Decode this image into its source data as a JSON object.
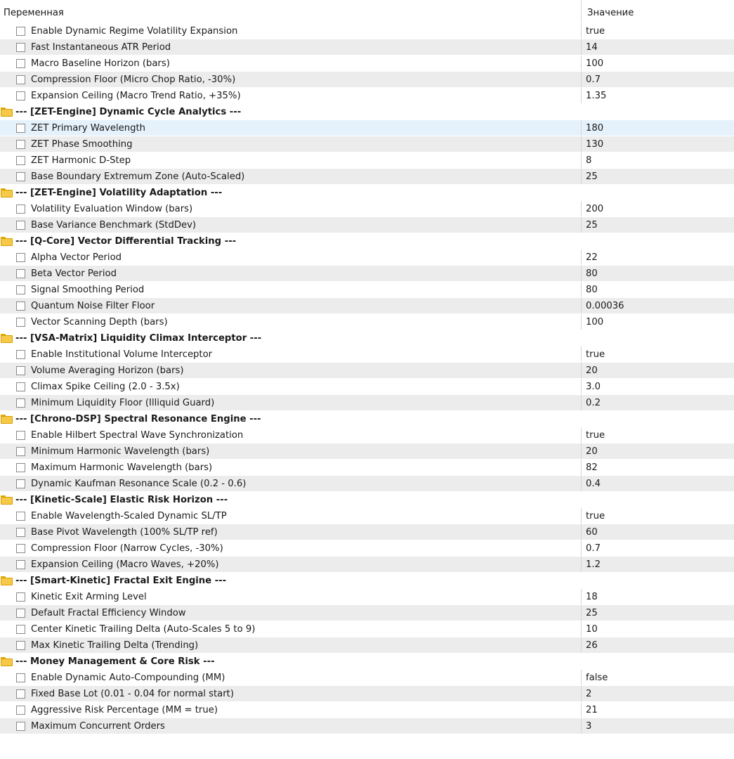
{
  "header": {
    "name_label": "Переменная",
    "value_label": "Значение"
  },
  "rows": [
    {
      "type": "param",
      "name": "Enable Dynamic Regime Volatility Expansion",
      "value": "true"
    },
    {
      "type": "param",
      "name": "Fast Instantaneous ATR Period",
      "value": "14"
    },
    {
      "type": "param",
      "name": "Macro Baseline Horizon (bars)",
      "value": "100"
    },
    {
      "type": "param",
      "name": "Compression Floor (Micro Chop Ratio, -30%)",
      "value": "0.7"
    },
    {
      "type": "param",
      "name": "Expansion Ceiling (Macro Trend Ratio, +35%)",
      "value": "1.35"
    },
    {
      "type": "group",
      "name": "--- [ZET-Engine] Dynamic Cycle Analytics ---"
    },
    {
      "type": "param",
      "name": "ZET Primary Wavelength",
      "value": "180",
      "selected": true
    },
    {
      "type": "param",
      "name": "ZET Phase Smoothing",
      "value": "130"
    },
    {
      "type": "param",
      "name": "ZET Harmonic D-Step",
      "value": "8"
    },
    {
      "type": "param",
      "name": "Base Boundary Extremum Zone (Auto-Scaled)",
      "value": "25"
    },
    {
      "type": "group",
      "name": "--- [ZET-Engine] Volatility Adaptation ---"
    },
    {
      "type": "param",
      "name": "Volatility Evaluation Window (bars)",
      "value": "200"
    },
    {
      "type": "param",
      "name": "Base Variance Benchmark (StdDev)",
      "value": "25"
    },
    {
      "type": "group",
      "name": "--- [Q-Core] Vector Differential Tracking ---"
    },
    {
      "type": "param",
      "name": "Alpha Vector Period",
      "value": "22"
    },
    {
      "type": "param",
      "name": "Beta Vector Period",
      "value": "80"
    },
    {
      "type": "param",
      "name": "Signal Smoothing Period",
      "value": "80"
    },
    {
      "type": "param",
      "name": "Quantum Noise Filter Floor",
      "value": "0.00036"
    },
    {
      "type": "param",
      "name": "Vector Scanning Depth (bars)",
      "value": "100"
    },
    {
      "type": "group",
      "name": "--- [VSA-Matrix] Liquidity Climax Interceptor ---"
    },
    {
      "type": "param",
      "name": "Enable Institutional Volume Interceptor",
      "value": "true"
    },
    {
      "type": "param",
      "name": "Volume Averaging Horizon (bars)",
      "value": "20"
    },
    {
      "type": "param",
      "name": "Climax Spike Ceiling (2.0 - 3.5x)",
      "value": "3.0"
    },
    {
      "type": "param",
      "name": "Minimum Liquidity Floor (Illiquid Guard)",
      "value": "0.2"
    },
    {
      "type": "group",
      "name": "--- [Chrono-DSP] Spectral Resonance Engine ---"
    },
    {
      "type": "param",
      "name": "Enable Hilbert Spectral Wave Synchronization",
      "value": "true"
    },
    {
      "type": "param",
      "name": "Minimum Harmonic Wavelength (bars)",
      "value": "20"
    },
    {
      "type": "param",
      "name": "Maximum Harmonic Wavelength (bars)",
      "value": "82"
    },
    {
      "type": "param",
      "name": "Dynamic Kaufman Resonance Scale (0.2 - 0.6)",
      "value": "0.4"
    },
    {
      "type": "group",
      "name": "--- [Kinetic-Scale] Elastic Risk Horizon ---"
    },
    {
      "type": "param",
      "name": "Enable Wavelength-Scaled Dynamic SL/TP",
      "value": "true"
    },
    {
      "type": "param",
      "name": "Base Pivot Wavelength (100% SL/TP ref)",
      "value": "60"
    },
    {
      "type": "param",
      "name": "Compression Floor (Narrow Cycles, -30%)",
      "value": "0.7"
    },
    {
      "type": "param",
      "name": "Expansion Ceiling (Macro Waves, +20%)",
      "value": "1.2"
    },
    {
      "type": "group",
      "name": "--- [Smart-Kinetic] Fractal Exit Engine ---"
    },
    {
      "type": "param",
      "name": "Kinetic Exit Arming Level",
      "value": "18"
    },
    {
      "type": "param",
      "name": "Default Fractal Efficiency Window",
      "value": "25"
    },
    {
      "type": "param",
      "name": "Center Kinetic Trailing Delta (Auto-Scales 5 to 9)",
      "value": "10"
    },
    {
      "type": "param",
      "name": "Max Kinetic Trailing Delta (Trending)",
      "value": "26"
    },
    {
      "type": "group",
      "name": "--- Money Management & Core Risk ---"
    },
    {
      "type": "param",
      "name": "Enable Dynamic Auto-Compounding (MM)",
      "value": "false"
    },
    {
      "type": "param",
      "name": "Fixed Base Lot (0.01 - 0.04 for normal start)",
      "value": "2"
    },
    {
      "type": "param",
      "name": "Aggressive Risk Percentage (MM = true)",
      "value": "21"
    },
    {
      "type": "param",
      "name": "Maximum Concurrent Orders",
      "value": "3"
    }
  ]
}
